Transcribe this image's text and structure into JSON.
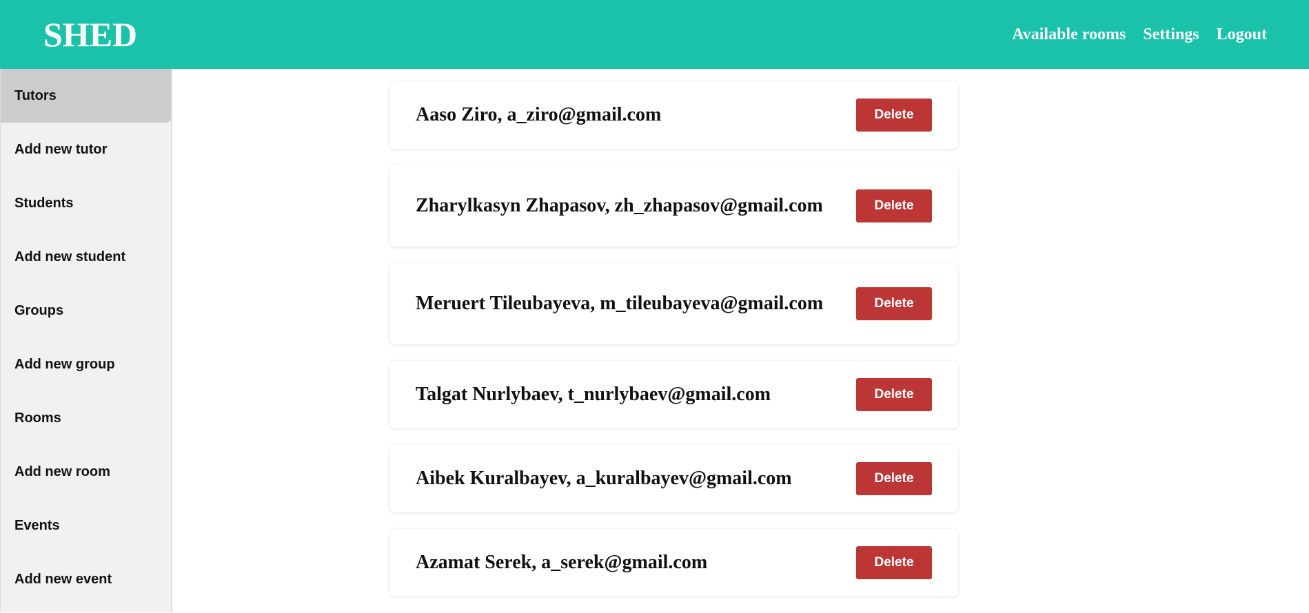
{
  "app": {
    "logo": "SHED"
  },
  "topnav": {
    "available_rooms": "Available rooms",
    "settings": "Settings",
    "logout": "Logout"
  },
  "sidebar": {
    "items": [
      {
        "label": "Tutors",
        "active": true
      },
      {
        "label": "Add new tutor"
      },
      {
        "label": "Students"
      },
      {
        "label": "Add new student"
      },
      {
        "label": "Groups"
      },
      {
        "label": "Add new group"
      },
      {
        "label": "Rooms"
      },
      {
        "label": "Add new room"
      },
      {
        "label": "Events"
      },
      {
        "label": "Add new event"
      }
    ]
  },
  "tutors": [
    {
      "text": "Aaso Ziro, a_ziro@gmail.com",
      "action": "Delete"
    },
    {
      "text": "Zharylkasyn Zhapasov, zh_zhapasov@gmail.com",
      "action": "Delete"
    },
    {
      "text": "Meruert Tileubayeva, m_tileubayeva@gmail.com",
      "action": "Delete"
    },
    {
      "text": "Talgat Nurlybaev, t_nurlybaev@gmail.com",
      "action": "Delete"
    },
    {
      "text": "Aibek Kuralbayev, a_kuralbayev@gmail.com",
      "action": "Delete"
    },
    {
      "text": "Azamat Serek, a_serek@gmail.com",
      "action": "Delete"
    }
  ],
  "colors": {
    "header": "#19c2a9",
    "delete": "#bd3636",
    "sidebar_bg": "#f1f1f1",
    "sidebar_active": "#cccccc"
  }
}
